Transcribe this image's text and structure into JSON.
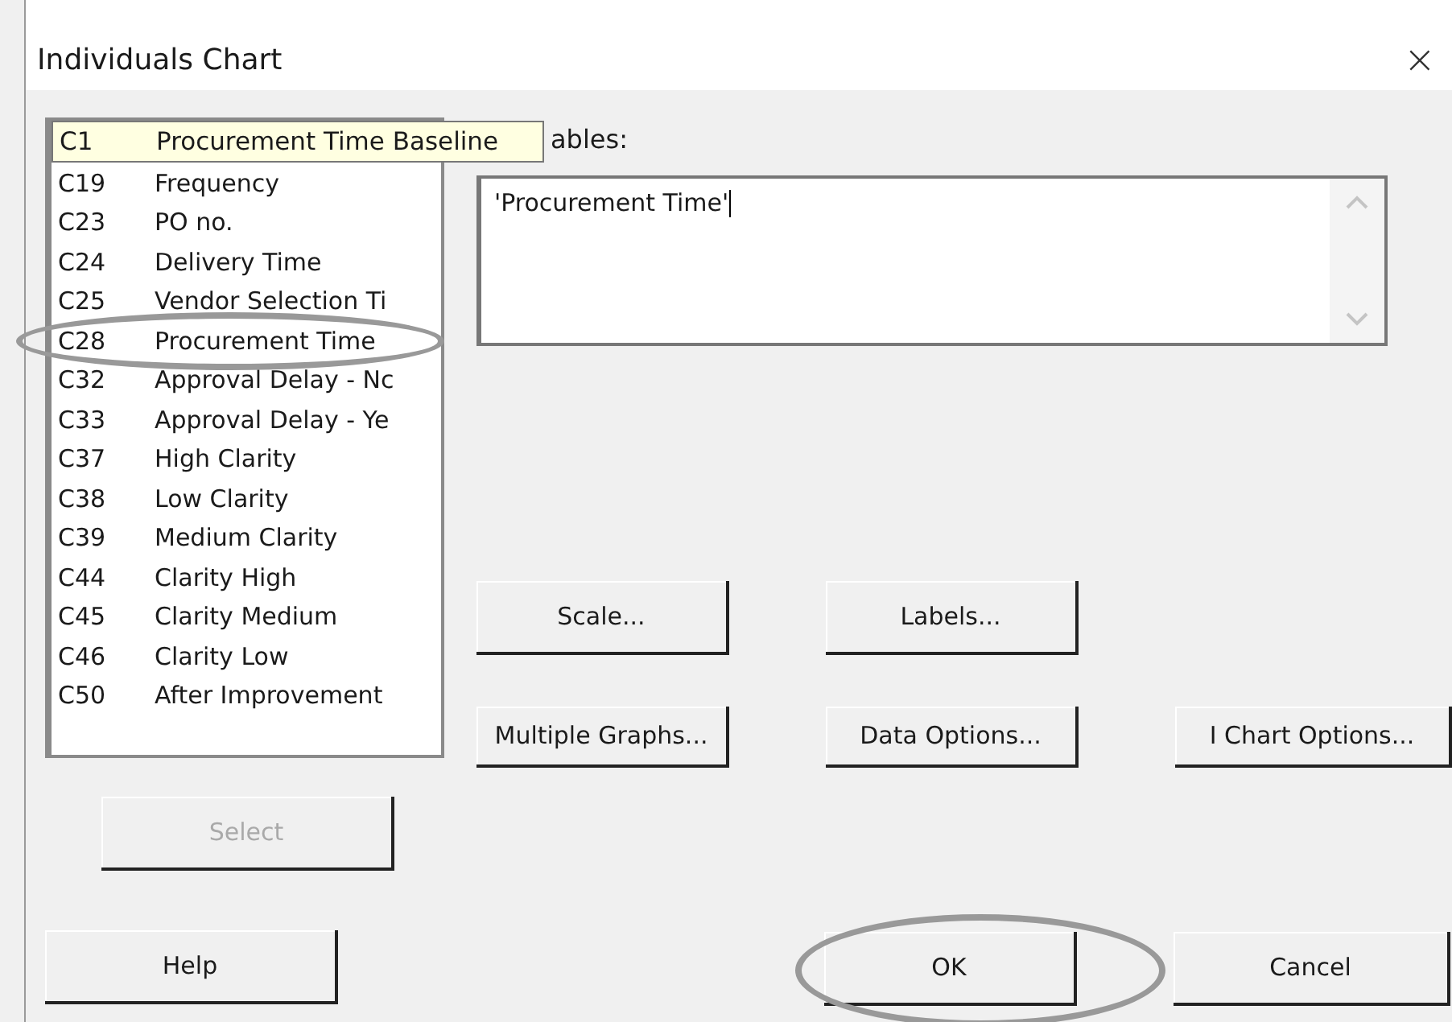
{
  "window": {
    "title": "Individuals Chart",
    "close": "×"
  },
  "columns_list": {
    "tooltip": {
      "id": "C1",
      "name": "Procurement Time Baseline"
    },
    "items": [
      {
        "id": "C19",
        "name": "Frequency",
        "highlighted": false
      },
      {
        "id": "C23",
        "name": "PO no.",
        "highlighted": false
      },
      {
        "id": "C24",
        "name": "Delivery Time",
        "highlighted": false
      },
      {
        "id": "C25",
        "name": "Vendor Selection Ti",
        "highlighted": false
      },
      {
        "id": "C28",
        "name": "Procurement Time",
        "highlighted": true
      },
      {
        "id": "C32",
        "name": "Approval Delay - Nc",
        "highlighted": false
      },
      {
        "id": "C33",
        "name": "Approval Delay - Ye",
        "highlighted": false
      },
      {
        "id": "C37",
        "name": "High Clarity",
        "highlighted": false
      },
      {
        "id": "C38",
        "name": "Low Clarity",
        "highlighted": false
      },
      {
        "id": "C39",
        "name": "Medium Clarity",
        "highlighted": false
      },
      {
        "id": "C44",
        "name": "Clarity High",
        "highlighted": false
      },
      {
        "id": "C45",
        "name": "Clarity Medium",
        "highlighted": false
      },
      {
        "id": "C46",
        "name": "Clarity Low",
        "highlighted": false
      },
      {
        "id": "C50",
        "name": "After Improvement",
        "highlighted": false
      }
    ]
  },
  "variables": {
    "label": "ables:",
    "value": "'Procurement Time'"
  },
  "option_buttons": [
    {
      "label": "Scale..."
    },
    {
      "label": "Labels..."
    },
    {
      "label": "Multiple Graphs..."
    },
    {
      "label": "Data Options..."
    },
    {
      "label": "I Chart Options..."
    }
  ],
  "select_button": {
    "label": "Select",
    "disabled": true
  },
  "help_button": {
    "label": "Help"
  },
  "bottom_buttons": [
    {
      "label": "OK",
      "highlighted": true
    },
    {
      "label": "Cancel",
      "highlighted": false
    }
  ]
}
